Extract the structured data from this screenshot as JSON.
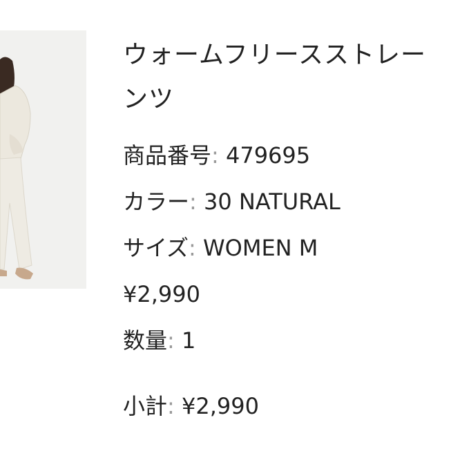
{
  "product": {
    "title_line1": "ウォームフリースストレー",
    "title_line2": "ンツ",
    "item_number_label": "商品番号",
    "item_number_value": "479695",
    "color_label": "カラー",
    "color_value": "30 NATURAL",
    "size_label": "サイズ",
    "size_value": "WOMEN M",
    "price": "¥2,990",
    "quantity_label": "数量",
    "quantity_value": "1",
    "subtotal_label": "小計",
    "subtotal_value": "¥2,990",
    "separator": ":"
  },
  "colors": {
    "text": "#222222",
    "photo_background": "#f1f1ef",
    "garment": "#efece4",
    "hair": "#3a2a22"
  }
}
